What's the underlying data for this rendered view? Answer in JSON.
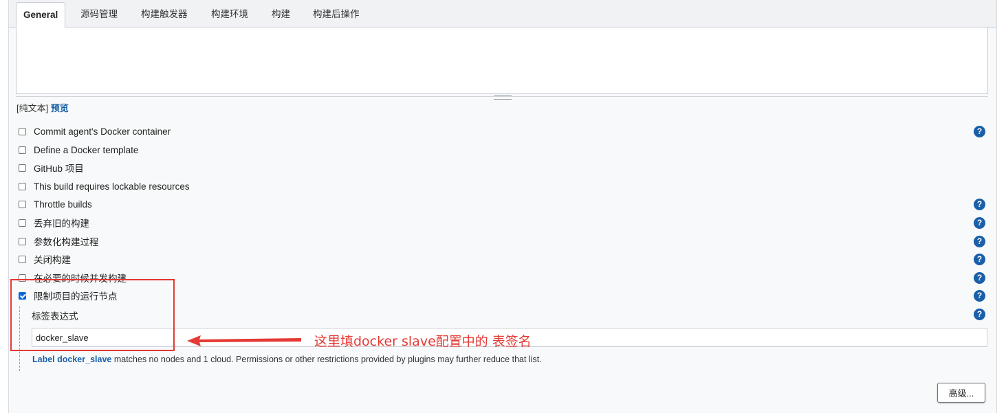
{
  "tabs": [
    {
      "label": "General",
      "active": true
    },
    {
      "label": "源码管理"
    },
    {
      "label": "构建触发器"
    },
    {
      "label": "构建环境"
    },
    {
      "label": "构建"
    },
    {
      "label": "构建后操作"
    }
  ],
  "description": {
    "value": "",
    "format_prefix": "[纯文本]",
    "preview_link": "预览"
  },
  "options": [
    {
      "label": "Commit agent's Docker container",
      "checked": false,
      "help": true
    },
    {
      "label": "Define a Docker template",
      "checked": false,
      "help": false
    },
    {
      "label": "GitHub 项目",
      "checked": false,
      "help": false
    },
    {
      "label": "This build requires lockable resources",
      "checked": false,
      "help": false
    },
    {
      "label": "Throttle builds",
      "checked": false,
      "help": true
    },
    {
      "label": "丢弃旧的构建",
      "checked": false,
      "help": true
    },
    {
      "label": "参数化构建过程",
      "checked": false,
      "help": true
    },
    {
      "label": "关闭构建",
      "checked": false,
      "help": true
    },
    {
      "label": "在必要的时候并发构建",
      "checked": false,
      "help": true
    },
    {
      "label": "限制项目的运行节点",
      "checked": true,
      "help": true
    }
  ],
  "label_expression": {
    "label": "标签表达式",
    "value": "docker_slave",
    "hint_link": "Label docker_slave",
    "hint_text": " matches no nodes and 1 cloud. Permissions or other restrictions provided by plugins may further reduce that list."
  },
  "advanced_button": "高级...",
  "help_glyph": "?",
  "annotation": {
    "text": "这里填docker slave配置中的 表签名",
    "color": "#e53935"
  },
  "colors": {
    "link": "#1a5fa8",
    "checkbox_checked": "#0a66d9",
    "annotation": "#e53935"
  }
}
